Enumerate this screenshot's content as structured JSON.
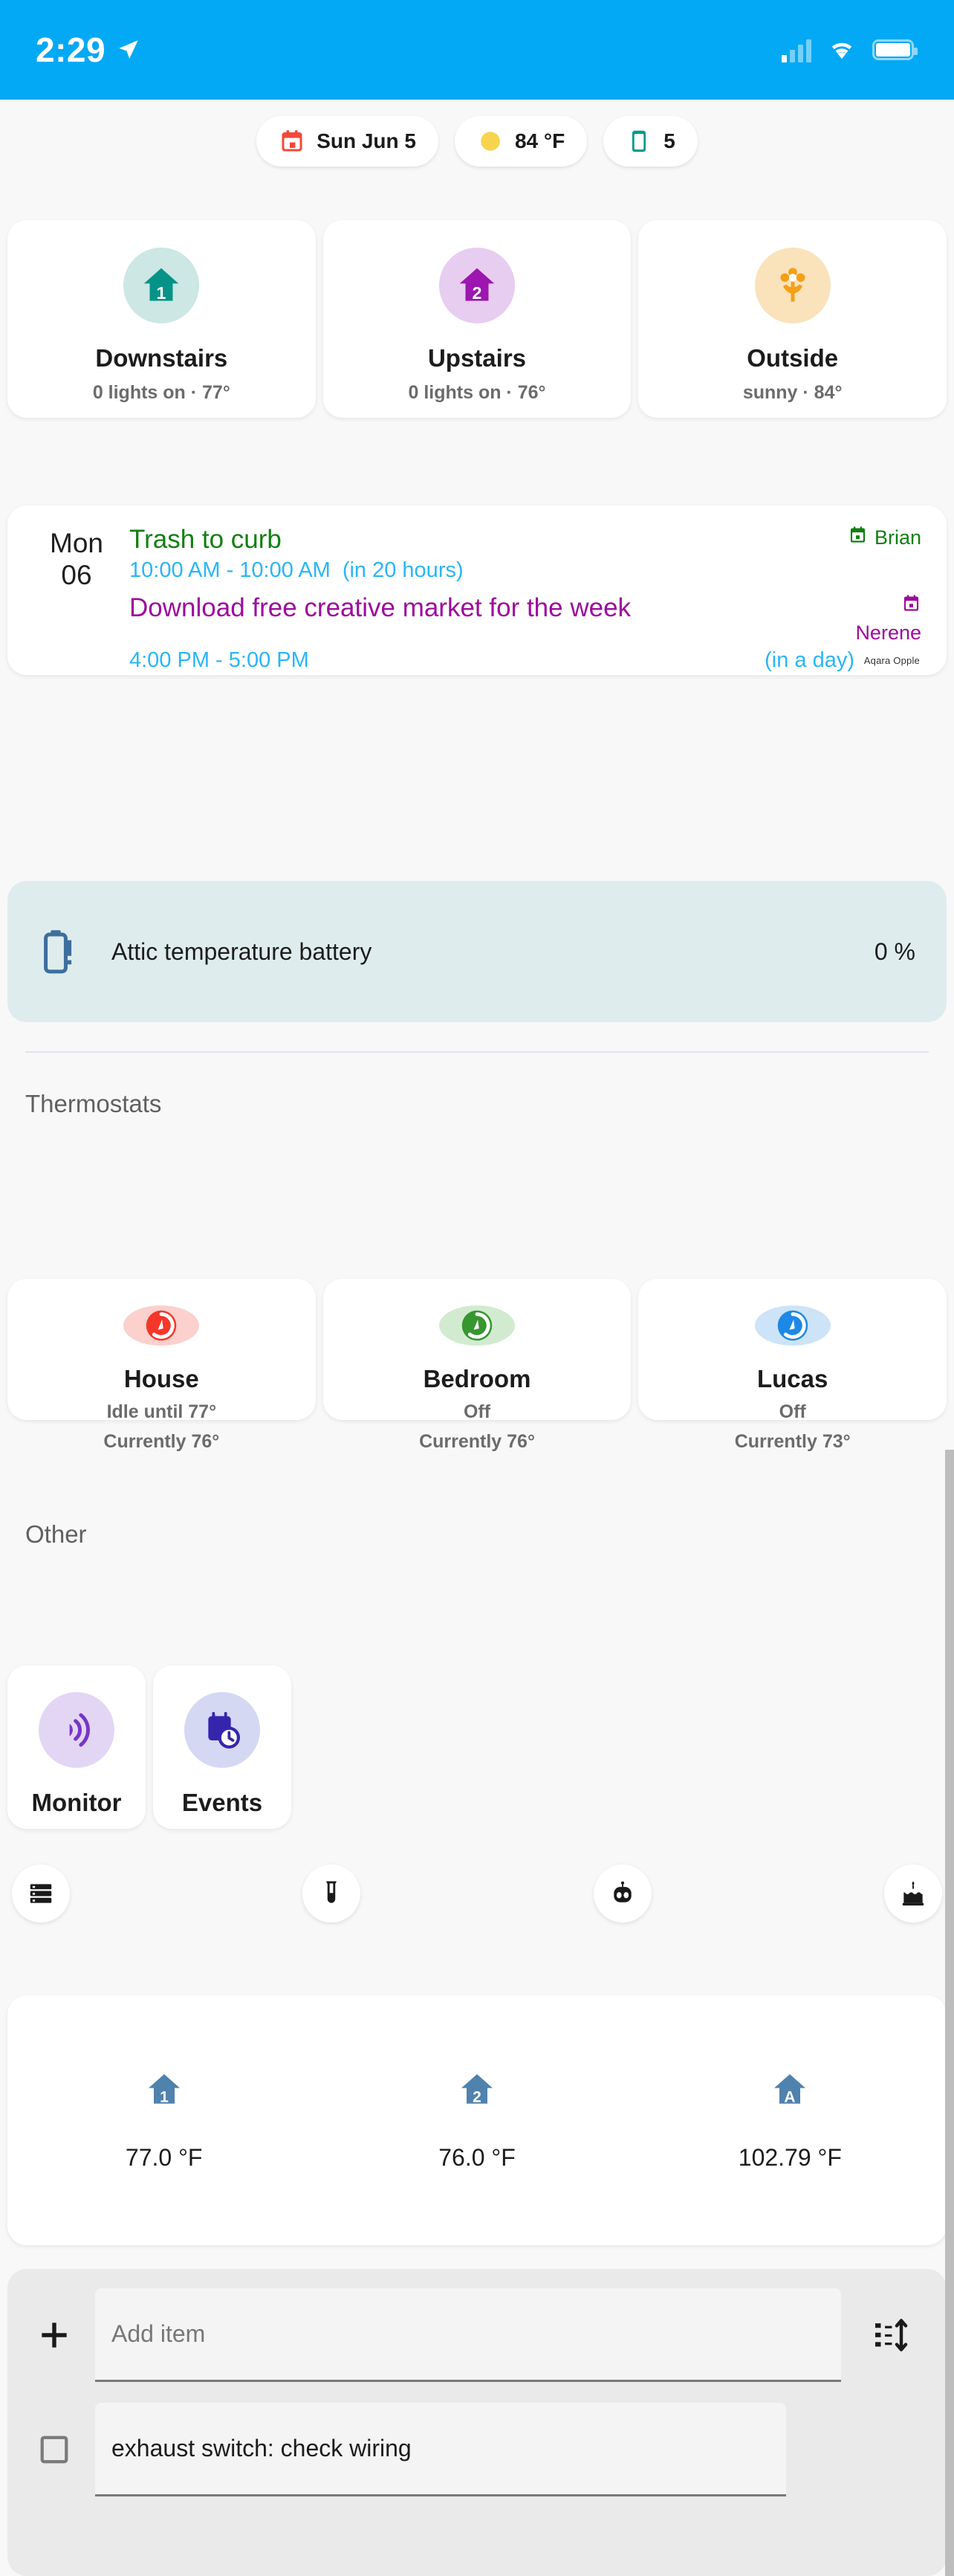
{
  "status_bar": {
    "time": "2:29",
    "nav_icon": "navigation-arrow-icon",
    "signal_icon": "cellular-signal-icon",
    "wifi_icon": "wifi-icon",
    "battery_icon": "battery-icon"
  },
  "chips": [
    {
      "icon": "calendar-icon",
      "label": "Sun Jun 5",
      "color": "#f4483c"
    },
    {
      "icon": "sun-icon",
      "label": "84 °F",
      "color": "#f7d44c"
    },
    {
      "icon": "tablet-icon",
      "label": "5",
      "color": "#00998a"
    }
  ],
  "areas": [
    {
      "name": "Downstairs",
      "status": "0 lights on · 77°",
      "icon": "home-floor-1-icon",
      "icon_color": "#069387",
      "bg_color": "#cce7e4"
    },
    {
      "name": "Upstairs",
      "status": "0 lights on · 76°",
      "icon": "home-floor-2-icon",
      "icon_color": "#9c16b0",
      "bg_color": "#e7cdf0"
    },
    {
      "name": "Outside",
      "status": "sunny · 84°",
      "icon": "flower-icon",
      "icon_color": "#f59f16",
      "bg_color": "#fae2bb"
    }
  ],
  "calendar": {
    "date_dow": "Mon",
    "date_day": "06",
    "attribution": "Aqara Opple",
    "events": [
      {
        "title": "Trash to curb",
        "time": "10:00 AM - 10:00 AM",
        "relative": "(in 20 hours)",
        "owner": "Brian",
        "owner_icon": "calendar-icon",
        "color": "#108010"
      },
      {
        "title": "Download free creative market for the week",
        "time": "4:00 PM - 5:00 PM",
        "relative": "(in a day)",
        "owner": "Nerene",
        "owner_icon": "calendar-icon",
        "color": "#9c0b9c"
      }
    ]
  },
  "battery_alert": {
    "icon": "battery-alert-icon",
    "label": "Attic temperature battery",
    "value": "0 %",
    "bg_color": "#dfeced",
    "icon_color": "#3d6e9e"
  },
  "sections": {
    "thermostats_title": "Thermostats",
    "other_title": "Other"
  },
  "thermostats": [
    {
      "name": "House",
      "line1": "Idle until 77°",
      "line2": "Currently 76°",
      "icon": "thermostat-icon",
      "icon_color": "#f5372a",
      "bg_color": "#fbd0cd"
    },
    {
      "name": "Bedroom",
      "line1": "Off",
      "line2": "Currently 76°",
      "icon": "thermostat-icon",
      "icon_color": "#37962f",
      "bg_color": "#d2ebd0"
    },
    {
      "name": "Lucas",
      "line1": "Off",
      "line2": "Currently 73°",
      "icon": "thermostat-icon",
      "icon_color": "#1d88e5",
      "bg_color": "#cde3f8"
    }
  ],
  "other": [
    {
      "name": "Monitor",
      "icon": "motion-sensor-icon",
      "icon_color": "#7436c7",
      "bg_color": "#e3d6f4"
    },
    {
      "name": "Events",
      "icon": "calendar-clock-icon",
      "icon_color": "#3525ad",
      "bg_color": "#d4d8f3"
    }
  ],
  "icon_row": [
    {
      "icon": "server-rack-icon"
    },
    {
      "icon": "test-tube-icon"
    },
    {
      "icon": "robot-icon"
    },
    {
      "icon": "birthday-cake-icon"
    }
  ],
  "temperatures": [
    {
      "icon": "home-floor-1-icon",
      "value": "77.0 °F"
    },
    {
      "icon": "home-floor-2-icon",
      "value": "76.0 °F"
    },
    {
      "icon": "home-floor-attic-icon",
      "value": "102.79 °F"
    }
  ],
  "shopping_list": {
    "add_placeholder": "Add item",
    "add_value": "",
    "add_icon": "plus-icon",
    "sort_icon": "sort-icon",
    "items": [
      {
        "text": "exhaust switch: check wiring",
        "checked": false,
        "checkbox_icon": "checkbox-unchecked-icon"
      }
    ]
  }
}
